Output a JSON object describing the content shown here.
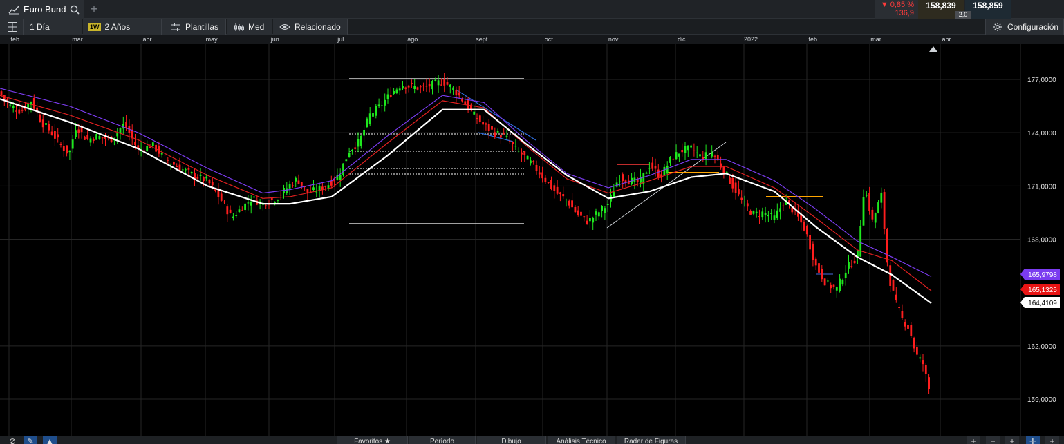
{
  "header": {
    "instrument": "Euro Bund",
    "change_pct": "▼ 0,85 %",
    "change_pts": "136,9",
    "bid": "158,839",
    "ask": "158,859",
    "spread": "2,0"
  },
  "toolbar": {
    "interval": "1 Día",
    "badge": "1W",
    "range": "2 Años",
    "templates": "Plantillas",
    "price_type": "Med",
    "related": "Relacionado",
    "settings": "Configuración"
  },
  "bottombar": {
    "favorites": "Favoritos",
    "period": "Período",
    "drawing": "Dibujo",
    "tech_analysis": "Análisis Técnico",
    "pattern_radar": "Radar de Figuras"
  },
  "colors": {
    "up": "#1ee81e",
    "down": "#ff1e1e",
    "ma_purple": "#7b3cf0",
    "ma_red": "#e02020",
    "ma_white": "#ffffff",
    "accent_orange": "#ffa500"
  },
  "chart_data": {
    "type": "candlestick",
    "month_labels": [
      "feb.",
      "mar.",
      "abr.",
      "may.",
      "jun.",
      "jul.",
      "ago.",
      "sept.",
      "oct.",
      "nov.",
      "dic.",
      "2022",
      "feb.",
      "mar.",
      "abr."
    ],
    "y_ticks": [
      "177,0000",
      "174,0000",
      "171,0000",
      "168,0000",
      "162,0000",
      "159,0000"
    ],
    "ylim": [
      158.0,
      179.0
    ],
    "price_path": [
      [
        0,
        176.2
      ],
      [
        15,
        175.5
      ],
      [
        30,
        175.2
      ],
      [
        45,
        175.8
      ],
      [
        60,
        174.6
      ],
      [
        75,
        174.0
      ],
      [
        90,
        173.2
      ],
      [
        100,
        172.8
      ],
      [
        110,
        174.4
      ],
      [
        125,
        173.6
      ],
      [
        140,
        173.8
      ],
      [
        160,
        173.6
      ],
      [
        180,
        174.5
      ],
      [
        200,
        173.0
      ],
      [
        220,
        173.3
      ],
      [
        240,
        172.5
      ],
      [
        260,
        172.0
      ],
      [
        280,
        171.6
      ],
      [
        300,
        171.3
      ],
      [
        320,
        170.2
      ],
      [
        335,
        169.2
      ],
      [
        350,
        169.8
      ],
      [
        365,
        170.3
      ],
      [
        380,
        170.0
      ],
      [
        400,
        170.3
      ],
      [
        415,
        170.9
      ],
      [
        430,
        171.4
      ],
      [
        445,
        170.6
      ],
      [
        460,
        170.8
      ],
      [
        475,
        171.1
      ],
      [
        490,
        171.6
      ],
      [
        505,
        173.0
      ],
      [
        520,
        173.5
      ],
      [
        535,
        175.0
      ],
      [
        550,
        175.5
      ],
      [
        565,
        176.2
      ],
      [
        580,
        176.7
      ],
      [
        595,
        176.6
      ],
      [
        610,
        176.5
      ],
      [
        625,
        176.7
      ],
      [
        640,
        176.9
      ],
      [
        655,
        176.5
      ],
      [
        670,
        175.8
      ],
      [
        685,
        175.0
      ],
      [
        700,
        174.4
      ],
      [
        715,
        174.0
      ],
      [
        730,
        173.8
      ],
      [
        745,
        173.1
      ],
      [
        760,
        172.6
      ],
      [
        775,
        172.0
      ],
      [
        790,
        171.3
      ],
      [
        805,
        170.6
      ],
      [
        820,
        170.2
      ],
      [
        835,
        169.4
      ],
      [
        850,
        169.0
      ],
      [
        865,
        169.5
      ],
      [
        880,
        170.0
      ],
      [
        895,
        171.5
      ],
      [
        910,
        171.3
      ],
      [
        925,
        171.2
      ],
      [
        940,
        172.2
      ],
      [
        955,
        171.5
      ],
      [
        970,
        172.5
      ],
      [
        985,
        173.0
      ],
      [
        1000,
        173.1
      ],
      [
        1015,
        172.6
      ],
      [
        1030,
        172.9
      ],
      [
        1045,
        172.0
      ],
      [
        1060,
        171.0
      ],
      [
        1075,
        170.0
      ],
      [
        1090,
        169.4
      ],
      [
        1105,
        169.5
      ],
      [
        1120,
        169.2
      ],
      [
        1135,
        170.2
      ],
      [
        1150,
        169.5
      ],
      [
        1165,
        168.5
      ],
      [
        1180,
        166.5
      ],
      [
        1195,
        165.5
      ],
      [
        1210,
        165.2
      ],
      [
        1225,
        166.4
      ],
      [
        1240,
        167.0
      ],
      [
        1250,
        171.0
      ],
      [
        1262,
        169.0
      ],
      [
        1275,
        170.5
      ],
      [
        1285,
        166.0
      ],
      [
        1295,
        164.5
      ],
      [
        1305,
        163.5
      ],
      [
        1315,
        163.0
      ],
      [
        1325,
        161.5
      ],
      [
        1335,
        161.0
      ],
      [
        1347,
        159.0
      ]
    ],
    "ma_purple_path": [
      [
        0,
        176.5
      ],
      [
        100,
        175.5
      ],
      [
        200,
        174.0
      ],
      [
        300,
        172.0
      ],
      [
        380,
        170.6
      ],
      [
        420,
        170.8
      ],
      [
        480,
        171.3
      ],
      [
        560,
        173.8
      ],
      [
        640,
        176.1
      ],
      [
        700,
        175.7
      ],
      [
        760,
        173.6
      ],
      [
        820,
        171.7
      ],
      [
        880,
        170.9
      ],
      [
        940,
        171.6
      ],
      [
        1000,
        172.5
      ],
      [
        1050,
        172.5
      ],
      [
        1120,
        171.3
      ],
      [
        1180,
        169.7
      ],
      [
        1240,
        167.9
      ],
      [
        1290,
        167.0
      ],
      [
        1347,
        165.9
      ]
    ],
    "ma_red_path": [
      [
        0,
        176.1
      ],
      [
        100,
        175.0
      ],
      [
        200,
        173.6
      ],
      [
        300,
        171.6
      ],
      [
        380,
        170.3
      ],
      [
        420,
        170.4
      ],
      [
        480,
        170.9
      ],
      [
        560,
        173.4
      ],
      [
        640,
        175.8
      ],
      [
        700,
        175.4
      ],
      [
        760,
        173.3
      ],
      [
        820,
        171.4
      ],
      [
        880,
        170.6
      ],
      [
        940,
        171.3
      ],
      [
        1000,
        172.1
      ],
      [
        1050,
        172.1
      ],
      [
        1120,
        170.9
      ],
      [
        1180,
        169.2
      ],
      [
        1240,
        167.4
      ],
      [
        1290,
        166.8
      ],
      [
        1347,
        165.1
      ]
    ],
    "ma_white_path": [
      [
        0,
        175.9
      ],
      [
        100,
        174.6
      ],
      [
        200,
        173.1
      ],
      [
        300,
        171.0
      ],
      [
        380,
        170.0
      ],
      [
        420,
        170.0
      ],
      [
        480,
        170.4
      ],
      [
        560,
        172.7
      ],
      [
        640,
        175.3
      ],
      [
        700,
        175.3
      ],
      [
        760,
        173.4
      ],
      [
        820,
        171.6
      ],
      [
        880,
        170.3
      ],
      [
        940,
        170.7
      ],
      [
        1000,
        171.5
      ],
      [
        1050,
        171.7
      ],
      [
        1120,
        170.7
      ],
      [
        1180,
        168.7
      ],
      [
        1240,
        167.0
      ],
      [
        1290,
        166.0
      ],
      [
        1347,
        164.4
      ]
    ],
    "last_values": [
      "165,9798",
      "165,1325",
      "164,4109"
    ]
  }
}
